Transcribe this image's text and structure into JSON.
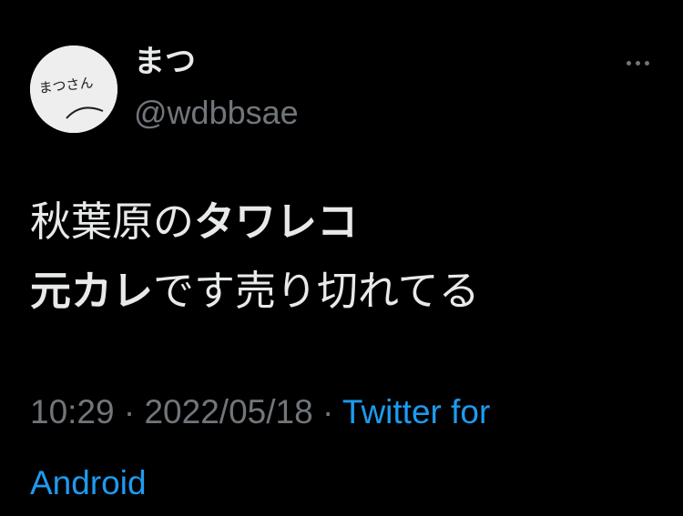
{
  "user": {
    "display_name": "まつ",
    "handle": "@wdbbsae",
    "avatar_text": "まつさん"
  },
  "tweet": {
    "line1_regular": "秋葉原の",
    "line1_bold": "タワレコ",
    "line2_bold": "元カレ",
    "line2_regular": "です売り切れてる"
  },
  "meta": {
    "time": "10:29",
    "separator": " · ",
    "date": "2022/05/18",
    "source_part1": "Twitter for",
    "source_part2": "Android"
  },
  "icons": {
    "more": "more-horizontal-icon"
  },
  "colors": {
    "background": "#000000",
    "text": "#e7e9ea",
    "secondary": "#71767b",
    "link": "#1d9bf0",
    "avatar_bg": "#eeeeee"
  }
}
